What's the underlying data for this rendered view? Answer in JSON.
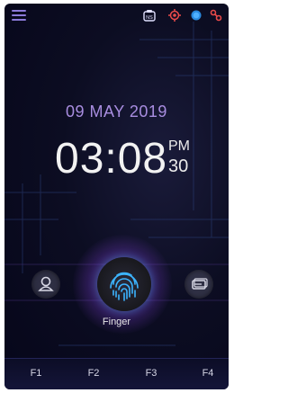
{
  "date": "09 MAY 2019",
  "time": {
    "hm": "03:08",
    "ampm": "PM",
    "seconds": "30"
  },
  "status_icons": [
    "ns-badge-icon",
    "location-target-icon",
    "network-globe-icon",
    "link-icon"
  ],
  "fingerprint": {
    "label": "Finger"
  },
  "side_buttons": [
    "user-icon",
    "card-icon"
  ],
  "function_keys": [
    "F1",
    "F2",
    "F3",
    "F4"
  ],
  "colors": {
    "accent": "#a88de0",
    "background": "#0c0d22",
    "glow": "#d050c8",
    "fingerprint": "#3cb4ff"
  }
}
